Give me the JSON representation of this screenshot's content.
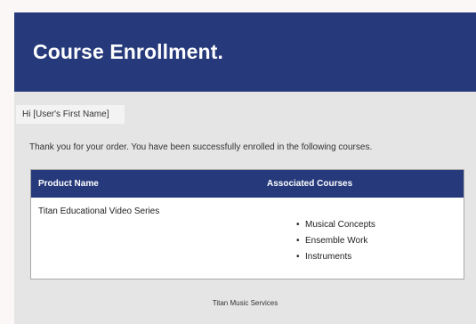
{
  "header": {
    "title": "Course Enrollment."
  },
  "greeting": "Hi [User's First Name]",
  "intro": "Thank you for your order. You have been successfully enrolled in the following courses.",
  "table": {
    "columns": [
      "Product Name",
      "Associated Courses"
    ],
    "rows": [
      {
        "product": "Titan Educational Video Series",
        "courses": [
          "Musical Concepts",
          "Ensemble Work",
          "Instruments"
        ]
      }
    ]
  },
  "footer": "Titan Music Services",
  "colors": {
    "brand": "#25397b",
    "background": "#e5e5e5"
  }
}
